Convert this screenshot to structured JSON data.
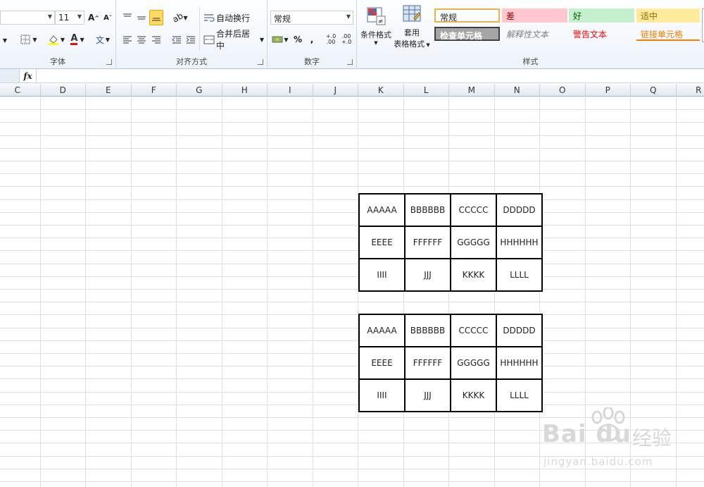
{
  "ribbon": {
    "font_group": {
      "label": "字体",
      "font_size": "11",
      "grow_font": "A",
      "shrink_font": "A"
    },
    "align_group": {
      "label": "对齐方式",
      "wrap_text": "自动换行",
      "merge_center": "合并后居中"
    },
    "number_group": {
      "label": "数字",
      "format_value": "常规",
      "percent": "%",
      "comma": ",",
      "inc_decimal": "+.0 .00",
      "dec_decimal": ".00 +.0"
    },
    "styles_group": {
      "label": "样式",
      "conditional_format": "条件格式",
      "table_format_line1": "套用",
      "table_format_line2": "表格格式",
      "cells": [
        {
          "label": "常规",
          "bg": "#ffffff",
          "fg": "#000000",
          "border": "#e8b44a"
        },
        {
          "label": "差",
          "bg": "#ffc7ce",
          "fg": "#9c0006"
        },
        {
          "label": "好",
          "bg": "#c6efce",
          "fg": "#006100"
        },
        {
          "label": "适中",
          "bg": "#ffeb9c",
          "fg": "#9c6500"
        },
        {
          "label": "检查单元格",
          "bg": "#a5a5a5",
          "fg": "#ffffff"
        },
        {
          "label": "解释性文本",
          "bg": "#ffffff",
          "fg": "#7f7f7f"
        },
        {
          "label": "警告文本",
          "bg": "#ffffff",
          "fg": "#ff0000"
        },
        {
          "label": "链接单元格",
          "bg": "#ffffff",
          "fg": "#fa7d00"
        }
      ]
    }
  },
  "formula_bar": {
    "fx": "fx",
    "content": ""
  },
  "columns": [
    "C",
    "D",
    "E",
    "F",
    "G",
    "H",
    "I",
    "J",
    "K",
    "L",
    "M",
    "N",
    "O",
    "P",
    "Q",
    "R"
  ],
  "tables": [
    {
      "rows": [
        [
          "AAAAA",
          "BBBBBB",
          "CCCCC",
          "DDDDD"
        ],
        [
          "EEEE",
          "FFFFFF",
          "GGGGG",
          "HHHHHH"
        ],
        [
          "IIII",
          "JJJ",
          "KKKK",
          "LLLL"
        ]
      ]
    },
    {
      "rows": [
        [
          "AAAAA",
          "BBBBBB",
          "CCCCC",
          "DDDDD"
        ],
        [
          "EEEE",
          "FFFFFF",
          "GGGGG",
          "HHHHHH"
        ],
        [
          "IIII",
          "JJJ",
          "KKKK",
          "LLLL"
        ]
      ]
    }
  ],
  "watermark": {
    "brand": "Bai du",
    "cn": "经验",
    "url": "jingyan.baidu.com"
  }
}
